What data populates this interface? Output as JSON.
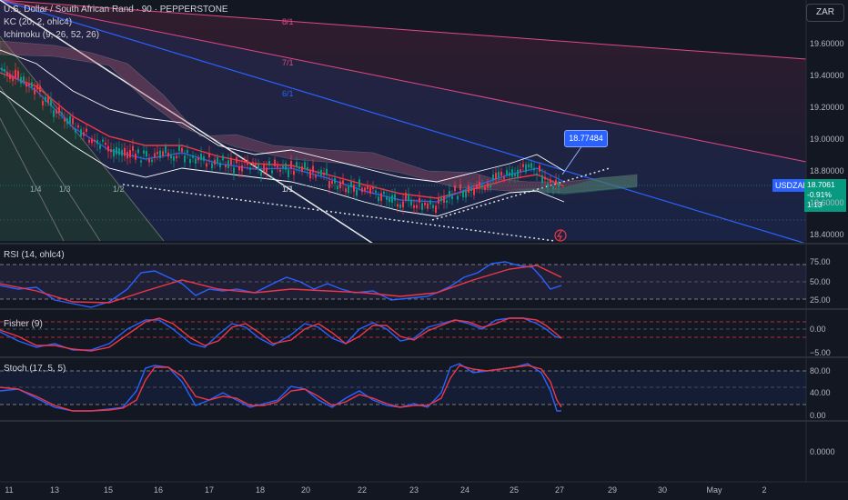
{
  "legends": {
    "main": "U.S. Dollar / South African Rand · 90 · PEPPERSTONE",
    "kc": "KC (20, 2, ohlc4)",
    "ichimoku": "Ichimoku (9, 26, 52, 26)",
    "rsi": "RSI (14, ohlc4)",
    "fisher": "Fisher (9)",
    "stoch": "Stoch (17, 5, 5)"
  },
  "currency_button": "ZAR",
  "symbol_tag": "USDZAR",
  "last_price_box": [
    "18.7061",
    "-0.91%",
    "1:13"
  ],
  "callout_price": "18.77484",
  "fib_labels": {
    "f81": "8/1",
    "f71": "7/1",
    "f61": "6/1",
    "f11": "1/1",
    "f14": "1/4",
    "f13": "1/3",
    "f12": "1/2"
  },
  "price_axis": [
    "19.60000",
    "19.40000",
    "19.20000",
    "19.00000",
    "18.80000",
    "18.60000",
    "18.40000"
  ],
  "rsi_axis": [
    "75.00",
    "50.00",
    "25.00"
  ],
  "fisher_axis": [
    "0.00",
    "−5.00"
  ],
  "stoch_axis": [
    "80.00",
    "40.00",
    "0.00"
  ],
  "bottom_axis": "0.0000",
  "date_axis": [
    "11",
    "13",
    "15",
    "16",
    "17",
    "18",
    "20",
    "22",
    "23",
    "24",
    "25",
    "27",
    "29",
    "30",
    "May",
    "2"
  ],
  "colors": {
    "background": "#131722",
    "up": "#089981",
    "down": "#f23645",
    "accent": "#2962ff",
    "kc": "#ffffff"
  }
}
